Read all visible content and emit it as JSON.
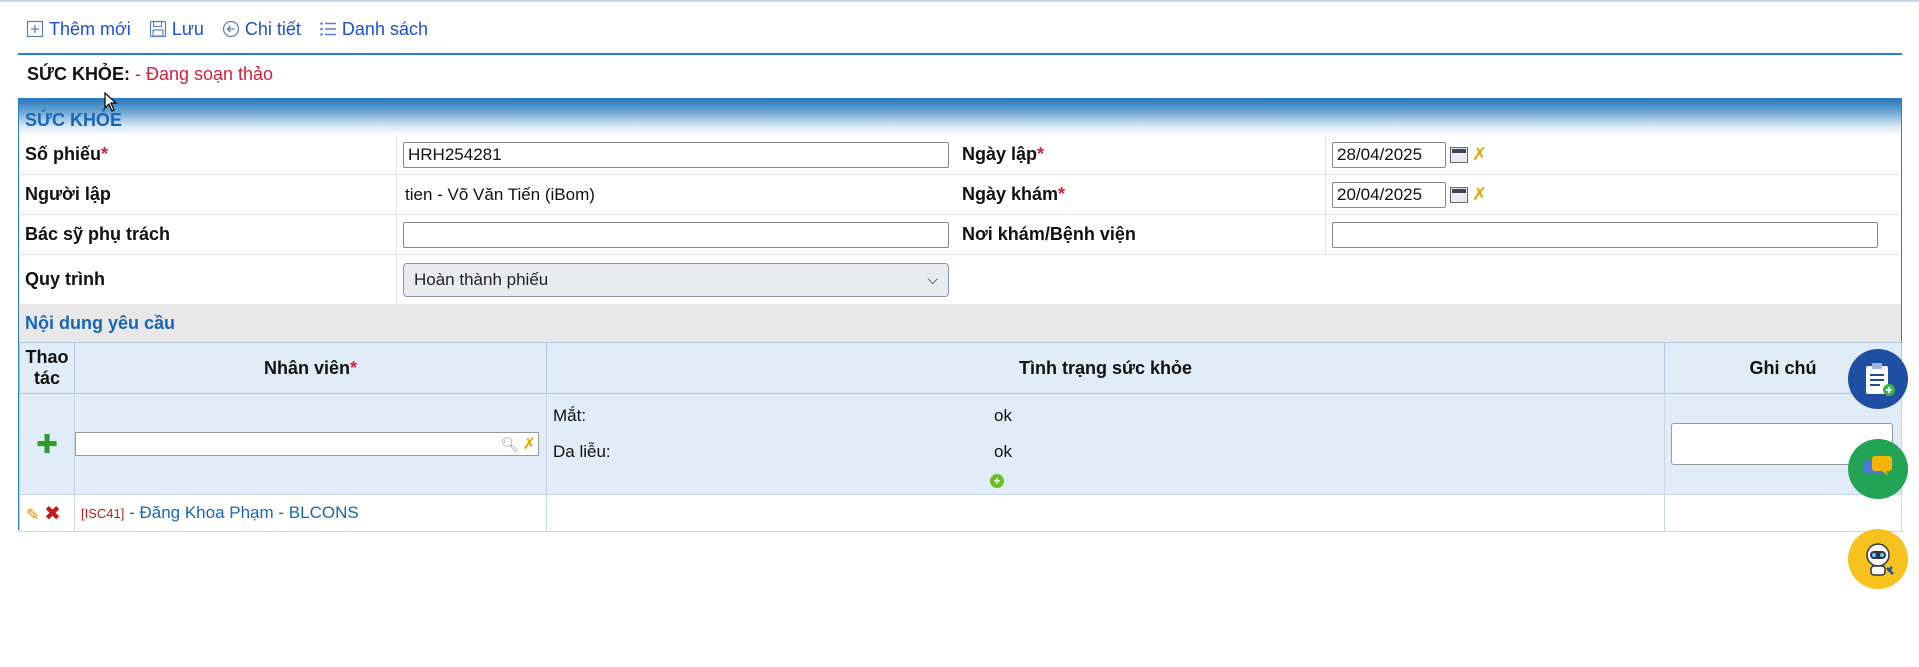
{
  "toolbar": {
    "add_new": "Thêm mới",
    "save": "Lưu",
    "detail": "Chi tiết",
    "list": "Danh sách"
  },
  "status": {
    "title": "SỨC KHỎE:",
    "state": "- Đang soạn thảo"
  },
  "form": {
    "header": "SỨC KHỎE",
    "ticket_no_label": "Số phiếu",
    "ticket_no_value": "HRH254281",
    "created_date_label": "Ngày lập",
    "created_date_value": "28/04/2025",
    "creator_label": "Người lập",
    "creator_value": "tien - Võ Văn Tiến (iBom)",
    "exam_date_label": "Ngày khám",
    "exam_date_value": "20/04/2025",
    "doctor_label": "Bác sỹ phụ trách",
    "doctor_value": "",
    "hospital_label": "Nơi khám/Bệnh viện",
    "hospital_value": "",
    "process_label": "Quy trình",
    "process_value": "Hoàn thành phiếu",
    "required_mark": "*"
  },
  "details": {
    "section_title": "Nội dung yêu cầu",
    "columns": {
      "action": "Thao tác",
      "employee": "Nhân viên",
      "health": "Tình trạng sức khỏe",
      "note": "Ghi chú"
    },
    "health_items": [
      {
        "label": "Mắt:",
        "value": "ok"
      },
      {
        "label": "Da liễu:",
        "value": "ok"
      }
    ],
    "rows": [
      {
        "code": "[ISC41]",
        "name": "- Đăng Khoa Phạm - BLCONS",
        "health": "",
        "note": ""
      }
    ]
  },
  "colors": {
    "link_blue": "#1a4fd8",
    "header_blue": "#1866b6",
    "required_red": "#d21f3c",
    "grid_header_bg": "#e0ecf8"
  }
}
